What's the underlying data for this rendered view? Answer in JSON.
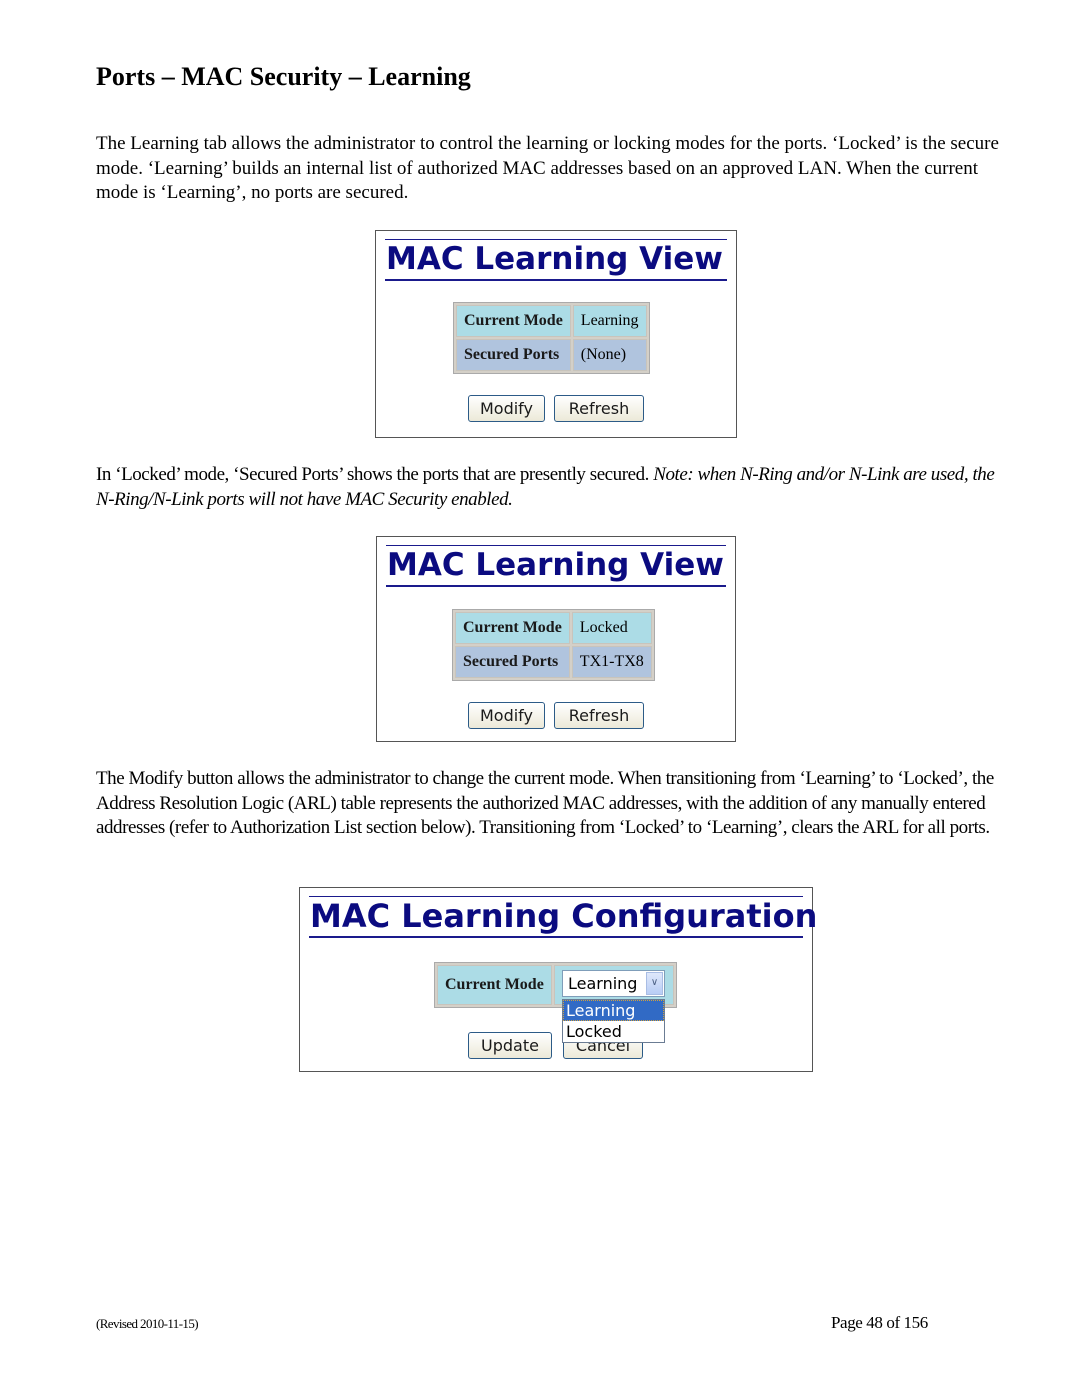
{
  "page": {
    "title": "Ports – MAC Security – Learning",
    "paragraphs": {
      "intro": "The Learning tab allows the administrator to control the learning or locking modes for the ports.  ‘Locked’ is the secure mode.  ‘Learning’ builds an internal list of authorized MAC addresses based on an approved LAN.  When the current mode is ‘Learning’, no ports are secured.",
      "locked_main": "In ‘Locked’ mode, ‘Secured Ports’ shows the ports that are presently secured.  ",
      "locked_note": "Note: when N-Ring and/or N-Link are used, the N-Ring/N-Link ports will not have MAC Security enabled.",
      "modify": "The Modify button allows the administrator to change the current mode.  When transitioning from ‘Learning’ to ‘Locked’, the Address Resolution Logic (ARL) table represents the authorized MAC addresses, with the addition of any manually entered addresses (refer to Authorization List section below).  Transitioning from ‘Locked’ to ‘Learning’, clears the ARL for all ports."
    },
    "footer": {
      "revised": "(Revised 2010-11-15)",
      "page_number": "Page 48 of 156"
    }
  },
  "screenshots": {
    "learning_view": {
      "title": "MAC Learning View",
      "rows": [
        {
          "label": "Current Mode",
          "value": "Learning"
        },
        {
          "label": "Secured Ports",
          "value": "(None)"
        }
      ],
      "buttons": {
        "modify": "Modify",
        "refresh": "Refresh"
      }
    },
    "locked_view": {
      "title": "MAC Learning View",
      "rows": [
        {
          "label": "Current Mode",
          "value": "Locked"
        },
        {
          "label": "Secured Ports",
          "value": "TX1-TX8"
        }
      ],
      "buttons": {
        "modify": "Modify",
        "refresh": "Refresh"
      }
    },
    "configuration": {
      "title": "MAC Learning Configuration",
      "current_mode_label": "Current Mode",
      "select_value": "Learning",
      "options": [
        "Learning",
        "Locked"
      ],
      "selected_option_index": 0,
      "buttons": {
        "update": "Update",
        "cancel": "Cancel"
      }
    }
  },
  "colors": {
    "title_blue": "#0b0b80",
    "row_cyan": "#acdce6",
    "row_lavender": "#b0c4de",
    "dropdown_highlight": "#316ac5"
  }
}
